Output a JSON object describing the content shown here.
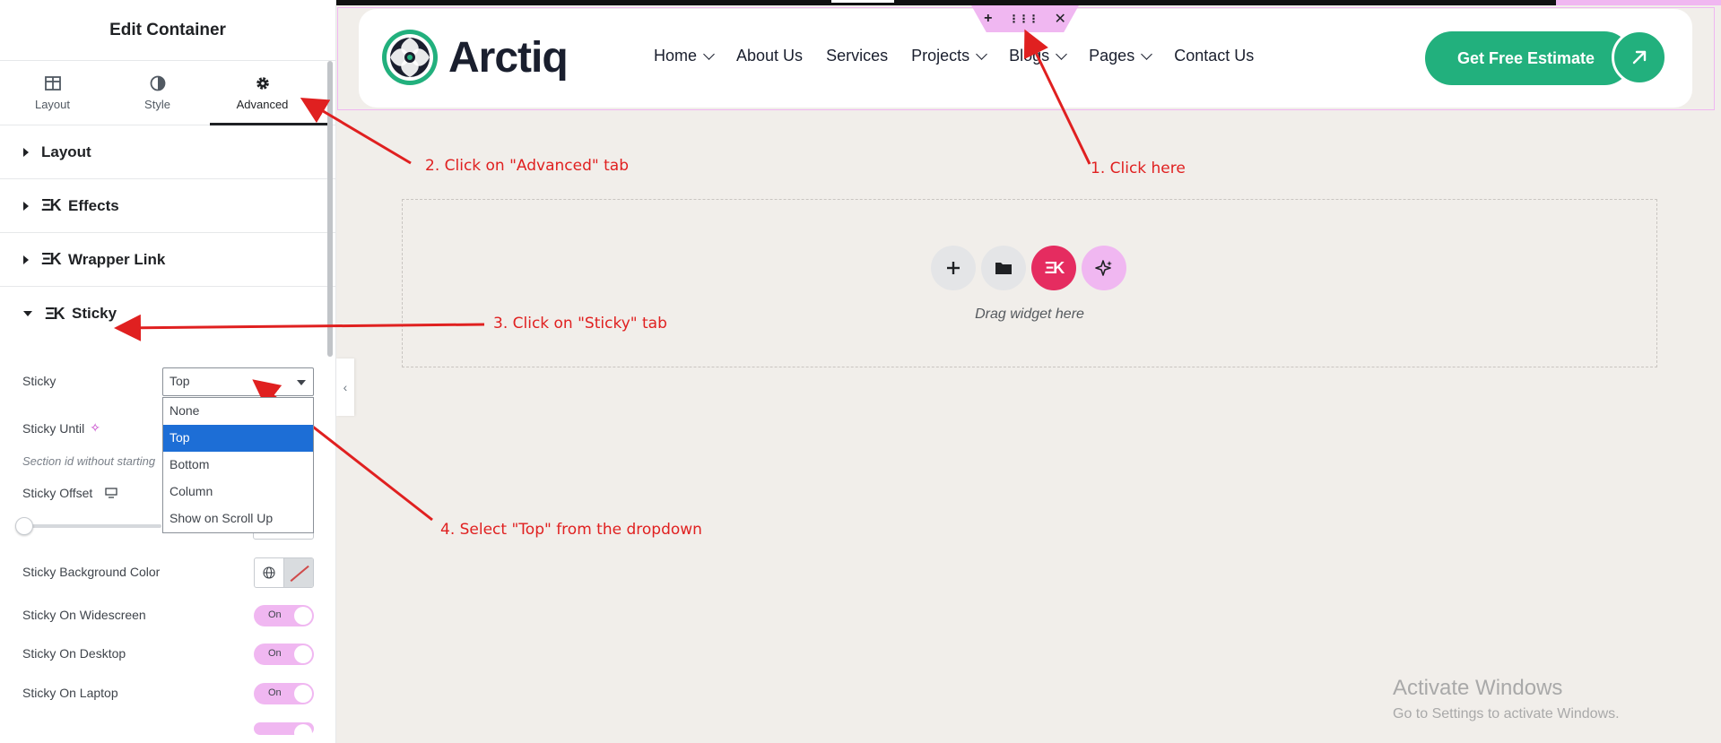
{
  "panel": {
    "title": "Edit Container",
    "tabs": [
      {
        "label": "Layout",
        "icon": "layout-columns-icon"
      },
      {
        "label": "Style",
        "icon": "half-circle-icon"
      },
      {
        "label": "Advanced",
        "icon": "gear-icon",
        "active": true
      }
    ],
    "sections": [
      {
        "label": "Layout"
      },
      {
        "label": "Effects"
      },
      {
        "label": "Wrapper Link"
      },
      {
        "label": "Sticky",
        "open": true
      }
    ],
    "sticky": {
      "sticky_label": "Sticky",
      "sticky_value": "Top",
      "options": [
        "None",
        "Top",
        "Bottom",
        "Column",
        "Show on Scroll Up"
      ],
      "selected_option": "Top",
      "sticky_until_label": "Sticky Until",
      "section_hint": "Section id without starting",
      "offset_label": "Sticky Offset",
      "offset_slider_value": 0,
      "bg_color_label": "Sticky Background Color",
      "toggles": [
        {
          "label": "Sticky On Widescreen",
          "value": "On"
        },
        {
          "label": "Sticky On Desktop",
          "value": "On"
        },
        {
          "label": "Sticky On Laptop",
          "value": "On"
        }
      ]
    }
  },
  "site": {
    "logo_text": "Arctiq",
    "nav": [
      {
        "label": "Home",
        "dropdown": true
      },
      {
        "label": "About Us",
        "dropdown": false
      },
      {
        "label": "Services",
        "dropdown": false
      },
      {
        "label": "Projects",
        "dropdown": true
      },
      {
        "label": "Blogs",
        "dropdown": true
      },
      {
        "label": "Pages",
        "dropdown": true
      },
      {
        "label": "Contact Us",
        "dropdown": false
      }
    ],
    "cta_label": "Get Free Estimate",
    "brand_color": "#22b07d"
  },
  "canvas": {
    "handle_icons": [
      "plus-icon",
      "drag-grip-icon",
      "close-icon"
    ],
    "dropzone_text": "Drag widget here",
    "dropzone_buttons": [
      "plus-icon",
      "folder-icon",
      "elementor-kit-icon",
      "ai-sparkle-icon"
    ]
  },
  "annotations": {
    "step1": "1. Click here",
    "step2": "2. Click on \"Advanced\" tab",
    "step3": "3. Click on \"Sticky\" tab",
    "step4": "4. Select \"Top\" from the dropdown"
  },
  "watermark": {
    "line1": "Activate Windows",
    "line2": "Go to Settings to activate Windows."
  },
  "colors": {
    "accent_pink": "#f0b7f1",
    "annotation_red": "#e02020",
    "select_highlight": "#1d6ed6"
  }
}
